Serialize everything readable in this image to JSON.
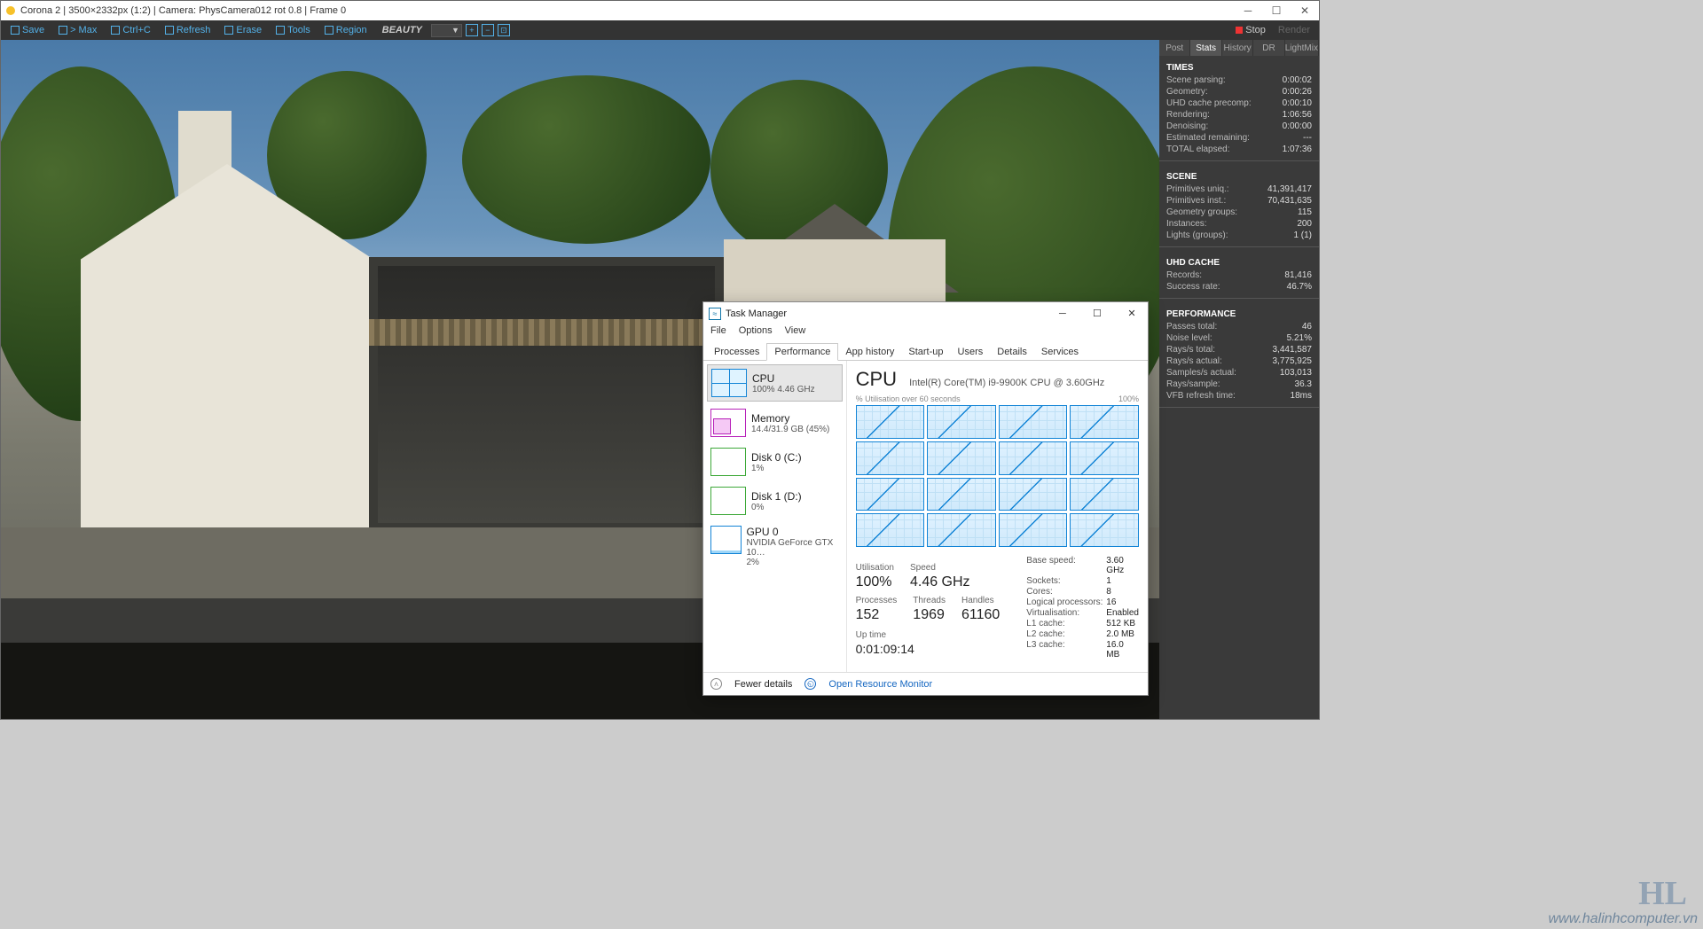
{
  "corona": {
    "title": "Corona 2 | 3500×2332px (1:2) | Camera: PhysCamera012 rot 0.8 | Frame 0",
    "toolbar": {
      "save": "Save",
      "max": "> Max",
      "ctrlc": "Ctrl+C",
      "refresh": "Refresh",
      "erase": "Erase",
      "tools": "Tools",
      "region": "Region",
      "channel": "BEAUTY",
      "stop": "Stop",
      "render": "Render"
    },
    "tabs": [
      "Post",
      "Stats",
      "History",
      "DR",
      "LightMix"
    ],
    "active_tab": 1,
    "groups": [
      {
        "head": "TIMES",
        "rows": [
          [
            "Scene parsing:",
            "0:00:02"
          ],
          [
            "Geometry:",
            "0:00:26"
          ],
          [
            "UHD cache precomp:",
            "0:00:10"
          ],
          [
            "Rendering:",
            "1:06:56"
          ],
          [
            "Denoising:",
            "0:00:00"
          ],
          [
            "Estimated remaining:",
            "---"
          ],
          [
            "TOTAL elapsed:",
            "1:07:36"
          ]
        ]
      },
      {
        "head": "SCENE",
        "rows": [
          [
            "Primitives uniq.:",
            "41,391,417"
          ],
          [
            "Primitives inst.:",
            "70,431,635"
          ],
          [
            "Geometry groups:",
            "115"
          ],
          [
            "Instances:",
            "200"
          ],
          [
            "Lights (groups):",
            "1 (1)"
          ]
        ]
      },
      {
        "head": "UHD CACHE",
        "rows": [
          [
            "Records:",
            "81,416"
          ],
          [
            "Success rate:",
            "46.7%"
          ]
        ]
      },
      {
        "head": "PERFORMANCE",
        "rows": [
          [
            "Passes total:",
            "46"
          ],
          [
            "Noise level:",
            "5.21%"
          ],
          [
            "Rays/s total:",
            "3,441,587"
          ],
          [
            "Rays/s actual:",
            "3,775,925"
          ],
          [
            "Samples/s actual:",
            "103,013"
          ],
          [
            "Rays/sample:",
            "36.3"
          ],
          [
            "VFB refresh time:",
            "18ms"
          ]
        ]
      }
    ]
  },
  "tm": {
    "title": "Task Manager",
    "menu": [
      "File",
      "Options",
      "View"
    ],
    "tabs": [
      "Processes",
      "Performance",
      "App history",
      "Start-up",
      "Users",
      "Details",
      "Services"
    ],
    "active_tab": 1,
    "left": [
      {
        "name": "CPU",
        "sub": "100%  4.46 GHz",
        "thumb": "cpu",
        "sel": true
      },
      {
        "name": "Memory",
        "sub": "14.4/31.9 GB (45%)",
        "thumb": "mem"
      },
      {
        "name": "Disk 0 (C:)",
        "sub": "1%",
        "thumb": "disk"
      },
      {
        "name": "Disk 1 (D:)",
        "sub": "0%",
        "thumb": "disk"
      },
      {
        "name": "GPU 0",
        "sub": "NVIDIA GeForce GTX 10…\n2%",
        "thumb": "gpu"
      }
    ],
    "head": {
      "big": "CPU",
      "sub": "Intel(R) Core(TM) i9-9900K CPU @ 3.60GHz"
    },
    "axis_left": "% Utilisation over 60 seconds",
    "axis_right": "100%",
    "stats": [
      {
        "l": "Utilisation",
        "v": "100%"
      },
      {
        "l": "Speed",
        "v": "4.46 GHz"
      }
    ],
    "stats2": [
      {
        "l": "Processes",
        "v": "152"
      },
      {
        "l": "Threads",
        "v": "1969"
      },
      {
        "l": "Handles",
        "v": "61160"
      }
    ],
    "uptime_l": "Up time",
    "uptime": "0:01:09:14",
    "spec": [
      [
        "Base speed:",
        "3.60 GHz"
      ],
      [
        "Sockets:",
        "1"
      ],
      [
        "Cores:",
        "8"
      ],
      [
        "Logical processors:",
        "16"
      ],
      [
        "Virtualisation:",
        "Enabled"
      ],
      [
        "L1 cache:",
        "512 KB"
      ],
      [
        "L2 cache:",
        "2.0 MB"
      ],
      [
        "L3 cache:",
        "16.0 MB"
      ]
    ],
    "fewer": "Fewer details",
    "orm": "Open Resource Monitor"
  },
  "watermark": "www.halinhcomputer.vn",
  "logo": "HL"
}
